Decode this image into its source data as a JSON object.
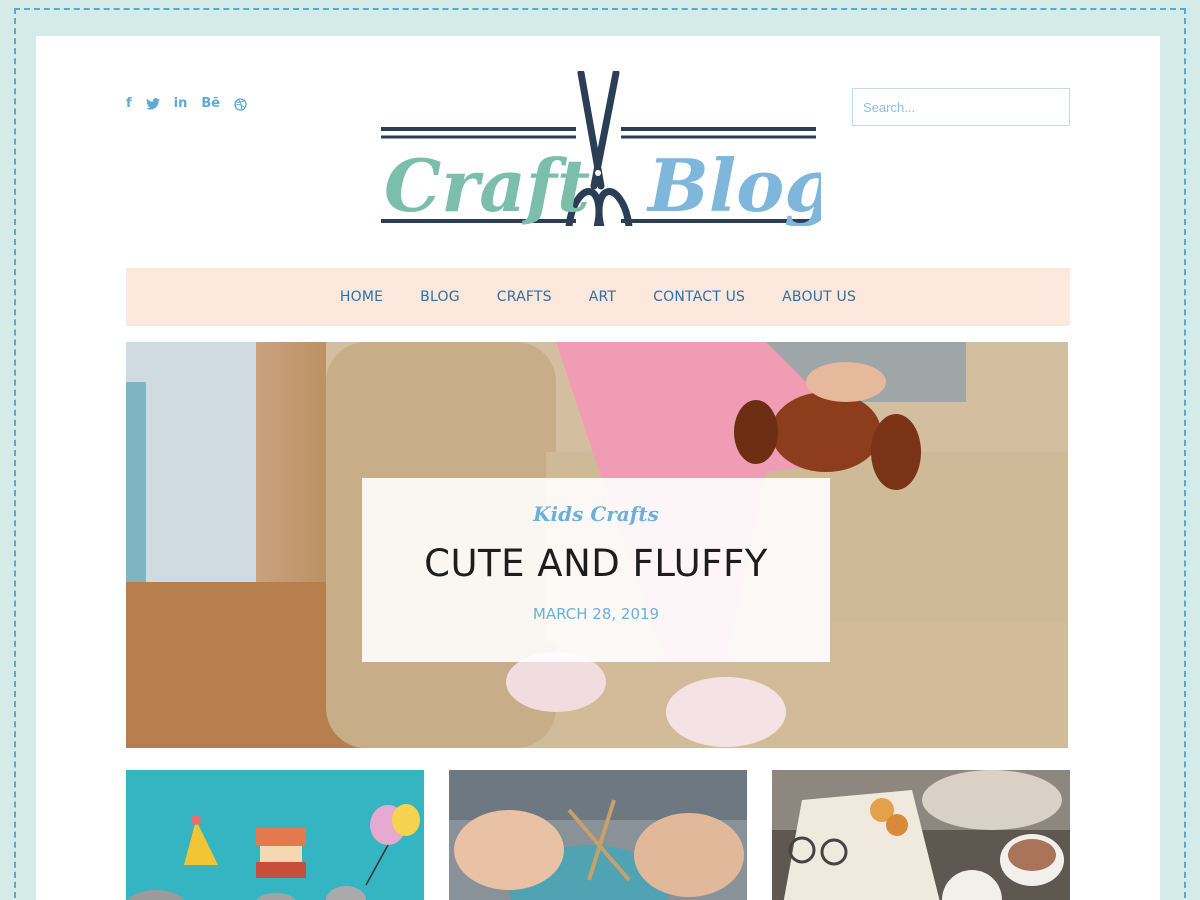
{
  "header": {
    "logo_word_left": "Craft",
    "logo_word_right": "Blog",
    "search_placeholder": "Search..."
  },
  "social": [
    {
      "name": "facebook-icon",
      "glyph": "f"
    },
    {
      "name": "twitter-icon",
      "glyph": "twitter"
    },
    {
      "name": "linkedin-icon",
      "glyph": "in"
    },
    {
      "name": "behance-icon",
      "glyph": "Bē"
    },
    {
      "name": "dribbble-icon",
      "glyph": "dribbble"
    }
  ],
  "nav": {
    "items": [
      "HOME",
      "BLOG",
      "CRAFTS",
      "ART",
      "CONTACT US",
      "ABOUT US"
    ]
  },
  "hero": {
    "category": "Kids Crafts",
    "title": "CUTE AND FLUFFY",
    "date": "MARCH 28, 2019"
  },
  "thumbs": [
    {
      "name": "thumb-party"
    },
    {
      "name": "thumb-knitting"
    },
    {
      "name": "thumb-reading"
    }
  ],
  "colors": {
    "page_bg": "#d4ebe8",
    "nav_bg": "#fde8de",
    "nav_text": "#2f6fa5",
    "accent_blue": "#6cb0d8",
    "logo_teal": "#7bbfaa",
    "logo_dark": "#2c3e55"
  }
}
